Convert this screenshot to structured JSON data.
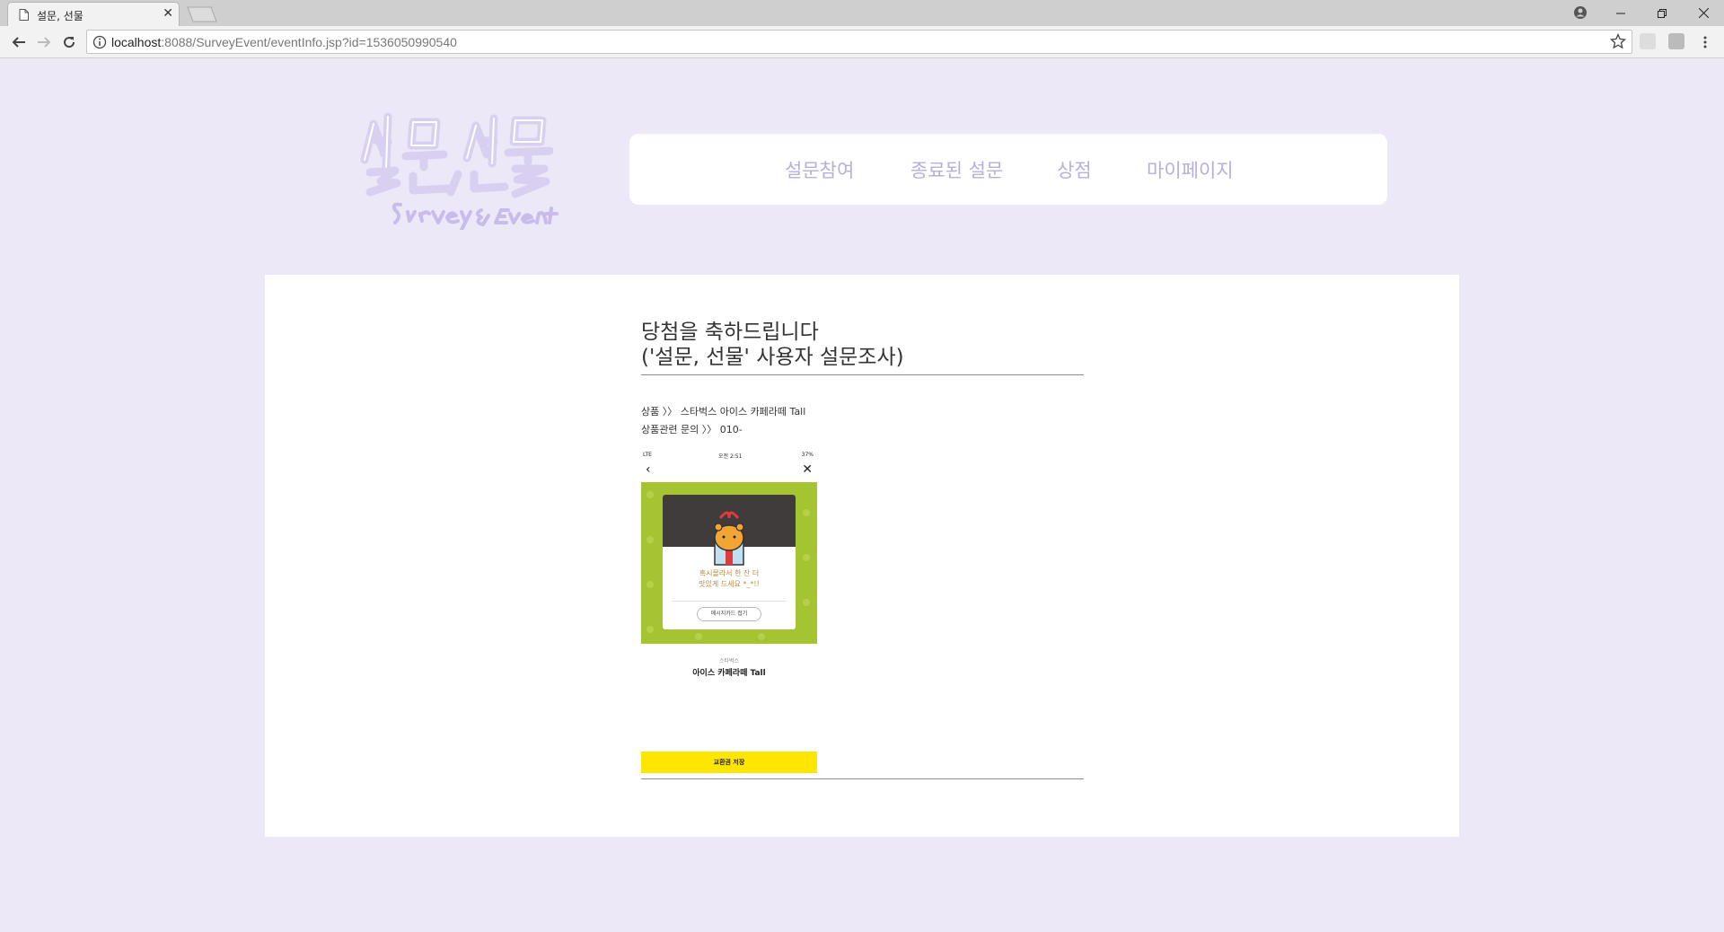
{
  "browser": {
    "tab_title": "설문, 선물",
    "url_host": "localhost",
    "url_rest": ":8088/SurveyEvent/eventInfo.jsp?id=1536050990540"
  },
  "nav": {
    "items": [
      "설문참여",
      "종료된 설문",
      "상점",
      "마이페이지"
    ]
  },
  "content": {
    "heading_line1": "당첨을 축하드립니다",
    "heading_line2": "('설문, 선물' 사용자 설문조사)",
    "product_line": "상품 〉〉 스타벅스 아이스 카페라떼 Tall",
    "contact_line": "상품관련 문의 〉〉 010-"
  },
  "phone": {
    "status_left": "LTE",
    "status_time": "오전 2:51",
    "status_right": "37%",
    "message_line1": "혹시몰라서 한 잔 더",
    "message_line2": "맛있게 드세요 *_*!!",
    "message_card_button": "메시지카드 접기",
    "brand": "스타벅스",
    "product_name": "아이스 카페라떼 Tall",
    "save_button": "교환권 저장"
  },
  "colors": {
    "page_bg": "#ede8f7",
    "nav_text": "#b8aedd",
    "logo": "#d6cdf0",
    "phone_green": "#a4c431",
    "save_yellow": "#ffe600"
  }
}
